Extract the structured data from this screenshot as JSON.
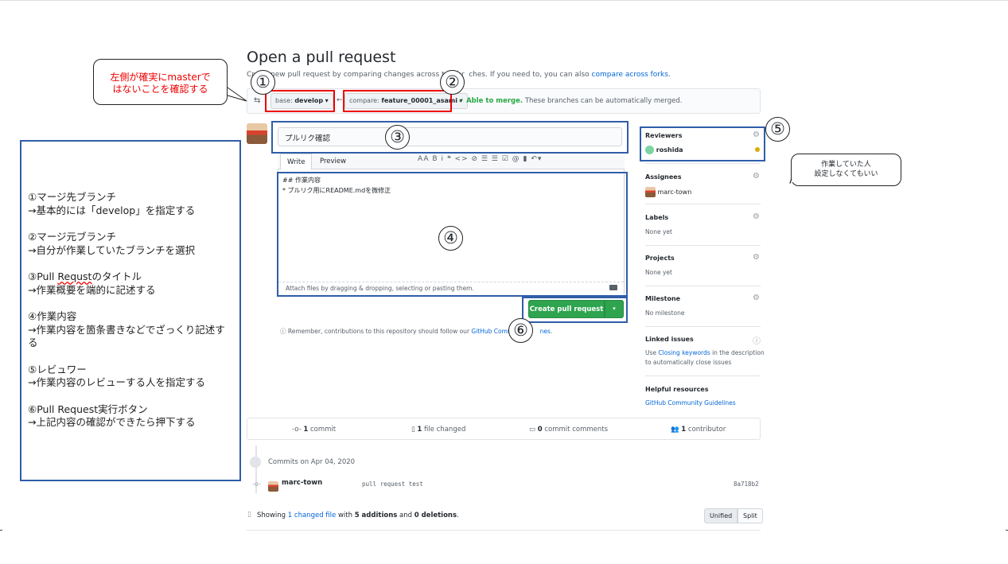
{
  "page": {
    "title": "Open a pull request",
    "subtitle_prefix": "Cr",
    "subtitle_text": "new pull request by comparing changes across two br",
    "subtitle_mid": "ches. If you need to, you can also",
    "subtitle_link": "compare across forks",
    "subtitle_end": "."
  },
  "range": {
    "base_label": "base:",
    "base_value": "develop",
    "compare_label": "compare:",
    "compare_value": "feature_00001_asami",
    "merge_status": "✓ Able to merge.",
    "merge_note": "These branches can be automatically merged."
  },
  "form": {
    "title_value": "プルリク確認",
    "tab_write": "Write",
    "tab_preview": "Preview",
    "toolbar_icons": "AA  B  i   ❝  <>  ⊘   ☰  ☰  ☑   @  ▮  ↶▾",
    "body": "## 作業内容\n* プルリク用にREADME.mdを微修正",
    "attach_text": "Attach files by dragging & dropping, selecting or pasting them.",
    "create_button": "Create pull request",
    "create_dropdown": "▾",
    "remember_prefix": "ⓘ Remember, contributions to this repository should follow our",
    "remember_link": "GitHub Commun",
    "remember_link2": "nes",
    "remember_end": "."
  },
  "sidebar": {
    "reviewers": {
      "heading": "Reviewers",
      "user": "roshida"
    },
    "assignees": {
      "heading": "Assignees",
      "user": "marc-town"
    },
    "labels": {
      "heading": "Labels",
      "value": "None yet"
    },
    "projects": {
      "heading": "Projects",
      "value": "None yet"
    },
    "milestone": {
      "heading": "Milestone",
      "value": "No milestone"
    },
    "linked": {
      "heading": "Linked issues",
      "text_pre": "Use",
      "link": "Closing keywords",
      "text_post": "in the description",
      "text_line2": "to automatically close issues"
    },
    "helpful": {
      "heading": "Helpful resources",
      "link": "GitHub Community Guidelines"
    }
  },
  "stats": {
    "commits": "1",
    "commits_label": "commit",
    "files": "1",
    "files_label": "file changed",
    "comments": "0",
    "comments_label": "commit comments",
    "contributors": "1",
    "contributors_label": "contributor"
  },
  "commits": {
    "date_label": "Commits on Apr 04, 2020",
    "author": "marc-town",
    "message": "pull request test",
    "sha": "8a718b2"
  },
  "diff": {
    "showing": "Showing",
    "changed_link": "1 changed file",
    "with": "with",
    "additions": "5 additions",
    "and": "and",
    "deletions": "0 deletions",
    "end": ".",
    "unified": "Unified",
    "split": "Split"
  },
  "annotations": {
    "callout_left": "左側が確実にmasterで\nはないことを確認する",
    "callout_right": "作業していた人\n設定しなくてもいい",
    "n1": "①",
    "n2": "②",
    "n3": "③",
    "n4": "④",
    "n5": "⑤",
    "n6": "⑥",
    "legend": [
      {
        "l1": "①マージ先ブランチ",
        "l2": "→基本的には「develop」を指定する"
      },
      {
        "l1": "②マージ元ブランチ",
        "l2": "→自分が作業していたブランチを選択"
      },
      {
        "l1a": "③Pull ",
        "l1b": "Requst",
        "l1c": "のタイトル",
        "l2": "→作業概要を端的に記述する"
      },
      {
        "l1": "④作業内容",
        "l2": "→作業内容を箇条書きなどでざっくり記述する"
      },
      {
        "l1": "⑤レビュワー",
        "l2": "→作業内容のレビューする人を指定する"
      },
      {
        "l1": "⑥Pull Request実行ボタン",
        "l2": "→上記内容の確認ができたら押下する"
      }
    ]
  },
  "colors": {
    "accent": "#2ea44f",
    "link": "#0366d6",
    "annotation_red": "#e00000",
    "annotation_blue": "#2f5ea8"
  }
}
